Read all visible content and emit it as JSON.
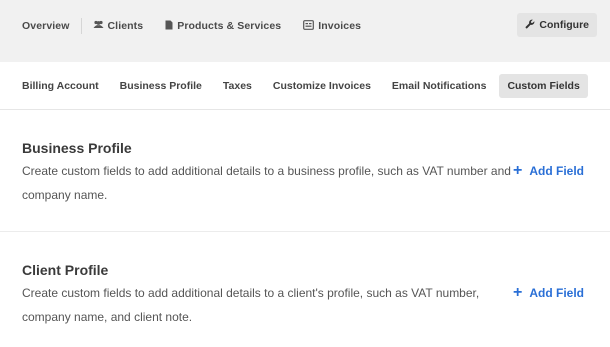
{
  "topnav": {
    "items": [
      {
        "label": "Overview",
        "icon": ""
      },
      {
        "label": "Clients",
        "icon": "users-icon"
      },
      {
        "label": "Products & Services",
        "icon": "document-icon"
      },
      {
        "label": "Invoices",
        "icon": "invoice-icon"
      }
    ],
    "configure_label": "Configure",
    "configure_icon": "wrench-icon"
  },
  "tabs": [
    {
      "label": "Billing Account",
      "active": false
    },
    {
      "label": "Business Profile",
      "active": false
    },
    {
      "label": "Taxes",
      "active": false
    },
    {
      "label": "Customize Invoices",
      "active": false
    },
    {
      "label": "Email Notifications",
      "active": false
    },
    {
      "label": "Custom Fields",
      "active": true
    }
  ],
  "sections": [
    {
      "title": "Business Profile",
      "description": "Create custom fields to add additional details to a business profile, such as VAT number and company name.",
      "action": "Add Field"
    },
    {
      "title": "Client Profile",
      "description": "Create custom fields to add additional details to a client's profile, such as VAT number, company name, and client note.",
      "action": "Add Field"
    }
  ],
  "colors": {
    "accent": "#2a6fd6",
    "topbar_bg": "#f1f1f1",
    "active_tab_bg": "#e4e4e4"
  }
}
